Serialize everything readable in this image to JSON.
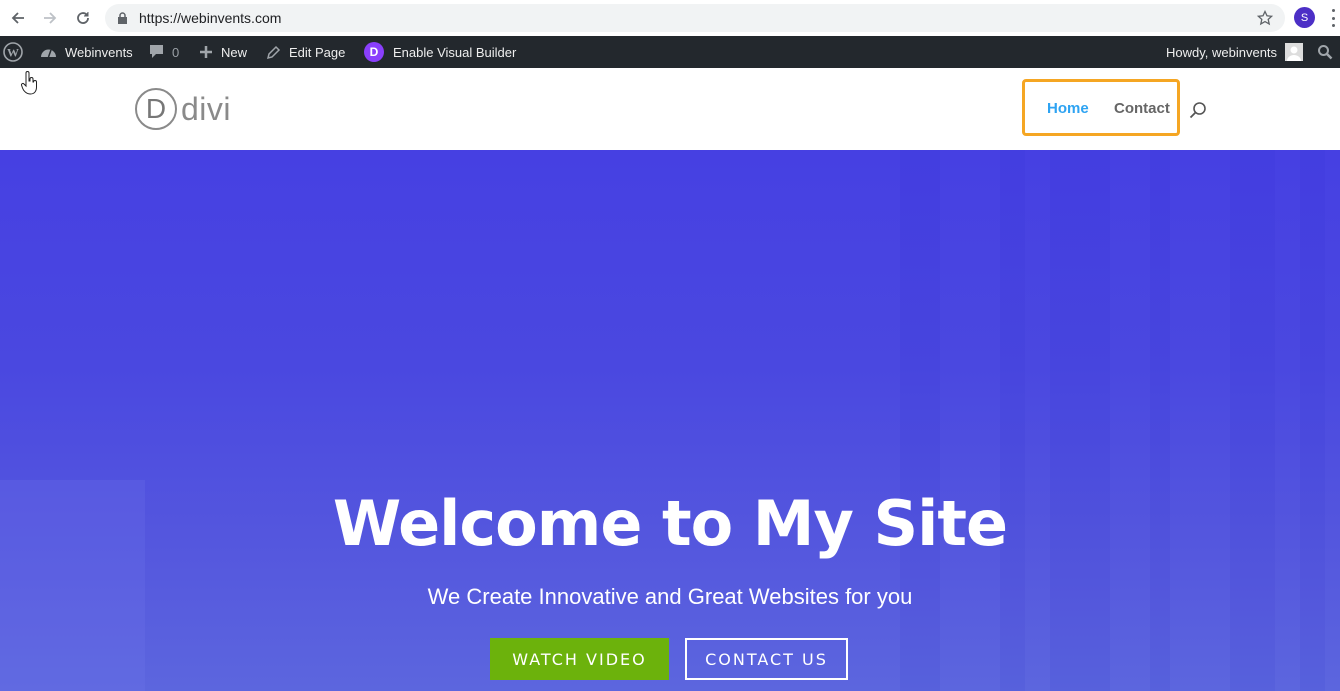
{
  "browser": {
    "url": "https://webinvents.com",
    "profile_initial": "S",
    "icons": [
      "back-arrow-icon",
      "forward-arrow-icon",
      "reload-icon",
      "lock-icon",
      "star-icon",
      "kebab-menu-icon"
    ]
  },
  "adminbar": {
    "site_name": "Webinvents",
    "comments_count": "0",
    "new_label": "New",
    "edit_label": "Edit Page",
    "divi_badge": "D",
    "visual_builder_label": "Enable Visual Builder",
    "howdy_label": "Howdy, webinvents"
  },
  "site": {
    "logo_letter": "D",
    "logo_word": "divi",
    "menu": [
      {
        "label": "Home",
        "active": true
      },
      {
        "label": "Contact",
        "active": false
      }
    ],
    "highlight_color": "#f5a623",
    "active_color": "#2ea3f2"
  },
  "hero": {
    "title": "Welcome to My Site",
    "subtitle": "We Create Innovative and Great Websites for you",
    "primary_button": "WATCH VIDEO",
    "secondary_button": "CONTACT US",
    "primary_color": "#6cb20c",
    "bg_color_top": "#4640e2",
    "bg_color_bottom": "#5c66de"
  }
}
